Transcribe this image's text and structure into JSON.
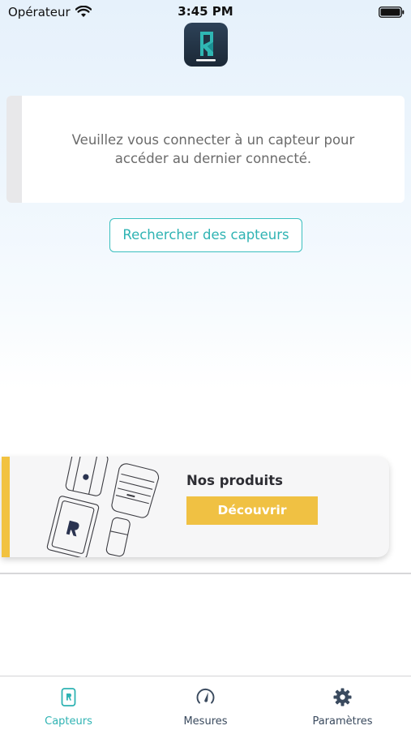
{
  "status_bar": {
    "carrier": "Opérateur",
    "time": "3:45 PM",
    "icons": [
      "wifi-icon",
      "battery-icon"
    ]
  },
  "app": {
    "logo_icon": "capteur-app-logo"
  },
  "info_card": {
    "line1": "Veuillez vous connecter à un capteur pour",
    "line2": "accéder au dernier connecté."
  },
  "search_button": {
    "label": "Rechercher des capteurs"
  },
  "products": {
    "title": "Nos produits",
    "button_label": "Découvrir",
    "illustration": "sensor-products-illustration"
  },
  "tab_bar": {
    "tabs": [
      {
        "label": "Capteurs",
        "icon": "sensor-icon",
        "active": true
      },
      {
        "label": "Mesures",
        "icon": "gauge-icon",
        "active": false
      },
      {
        "label": "Paramètres",
        "icon": "gear-icon",
        "active": false
      }
    ]
  },
  "colors": {
    "accent_teal": "#2fb3b3",
    "product_yellow": "#f0c143",
    "inactive_tab": "#3a4a5e"
  }
}
